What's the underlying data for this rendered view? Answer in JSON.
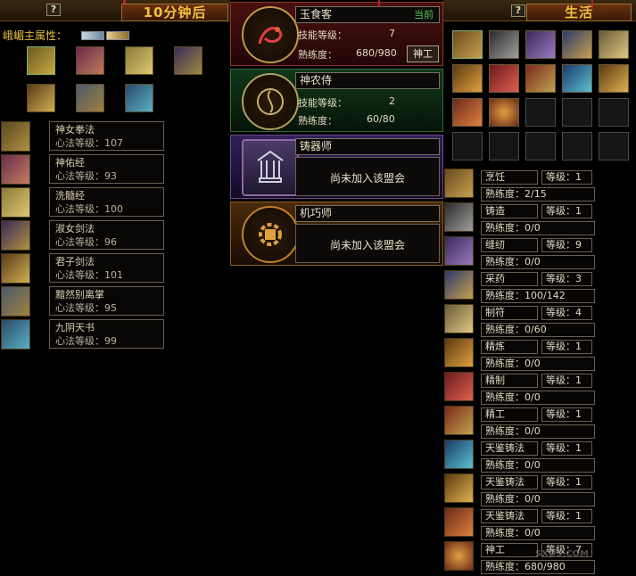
{
  "left_panel": {
    "help_label": "?",
    "banner_text": "10分钟后",
    "attr_label": "峨嵋主属性：",
    "kungfu_list": [
      {
        "name": "神女拳法",
        "level": "心法等级：107"
      },
      {
        "name": "神佑经",
        "level": "心法等级：93"
      },
      {
        "name": "洗髓经",
        "level": "心法等级：100"
      },
      {
        "name": "淑女剑法",
        "level": "心法等级：96"
      },
      {
        "name": "君子剑法",
        "level": "心法等级：101"
      },
      {
        "name": "黯然别离掌",
        "level": "心法等级：95"
      },
      {
        "name": "九阴天书",
        "level": "心法等级：99"
      }
    ]
  },
  "guilds": [
    {
      "name": "玉食客",
      "tag": "当前",
      "skill_label": "技能等级：",
      "skill_value": "7",
      "prof_label": "熟练度：",
      "prof_value": "680/980",
      "button": "神工"
    },
    {
      "name": "神农侍",
      "skill_label": "技能等级：",
      "skill_value": "2",
      "prof_label": "熟练度：",
      "prof_value": "60/80"
    },
    {
      "name": "铸器师",
      "status": "尚未加入该盟会"
    },
    {
      "name": "机巧师",
      "status": "尚未加入该盟会"
    }
  ],
  "right_panel": {
    "help_label": "?",
    "banner_text": "生活",
    "skills": [
      {
        "name": "烹饪",
        "level": "等级：1",
        "prof": "熟练度：2/15"
      },
      {
        "name": "铸造",
        "level": "等级：1",
        "prof": "熟练度：0/0"
      },
      {
        "name": "缝纫",
        "level": "等级：9",
        "prof": "熟练度：0/0"
      },
      {
        "name": "采药",
        "level": "等级：3",
        "prof": "熟练度：100/142"
      },
      {
        "name": "制符",
        "level": "等级：4",
        "prof": "熟练度：0/60"
      },
      {
        "name": "精炼",
        "level": "等级：1",
        "prof": "熟练度：0/0"
      },
      {
        "name": "精制",
        "level": "等级：1",
        "prof": "熟练度：0/0"
      },
      {
        "name": "精工",
        "level": "等级：1",
        "prof": "熟练度：0/0"
      },
      {
        "name": "天鉴铸法",
        "level": "等级：1",
        "prof": "熟练度：0/0"
      },
      {
        "name": "天鉴铸法",
        "level": "等级：1",
        "prof": "熟练度：0/0"
      },
      {
        "name": "天鉴铸法",
        "level": "等级：1",
        "prof": "熟练度：0/0"
      },
      {
        "name": "神工",
        "level": "等级：7",
        "prof": "熟练度：680/980"
      }
    ]
  },
  "watermark": "SXDS.COM",
  "colors": {
    "accent_gold": "#e8c040",
    "current_green": "#50c850",
    "tip_red": "#b2222a"
  }
}
